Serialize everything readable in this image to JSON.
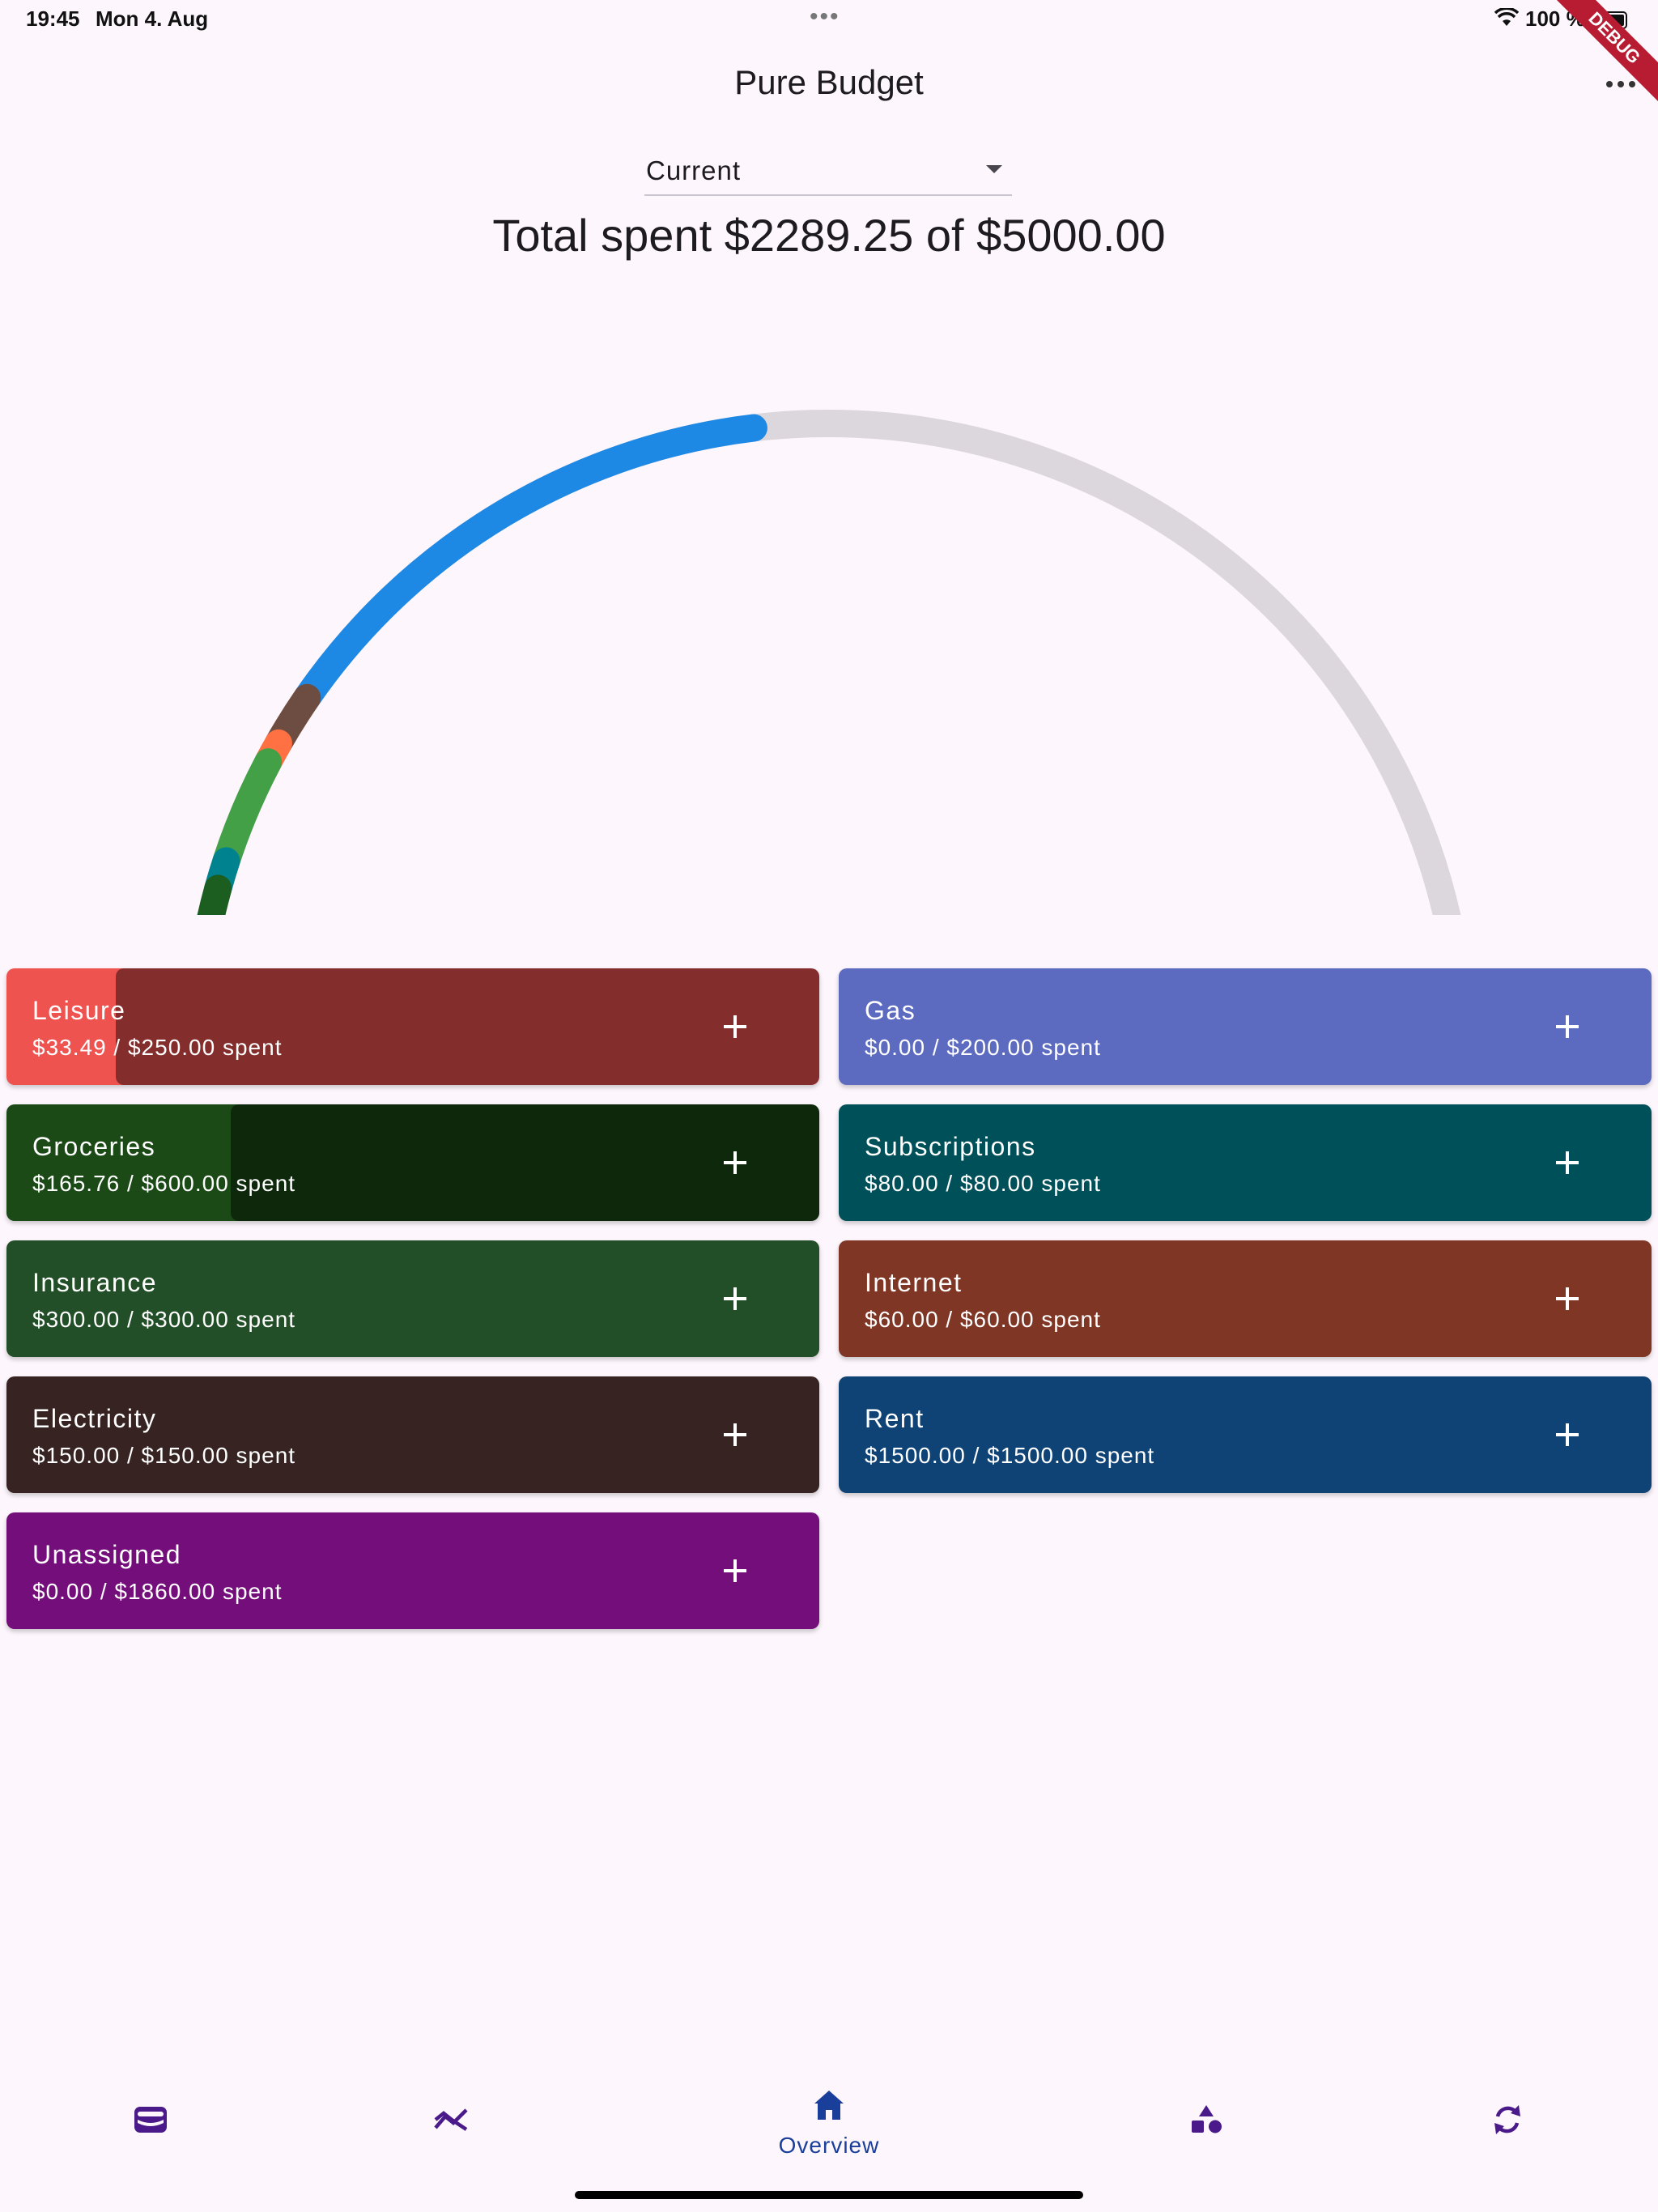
{
  "status_bar": {
    "time": "19:45",
    "date": "Mon 4. Aug",
    "battery": "100 %",
    "dots": "•••"
  },
  "debug_banner": "DEBUG",
  "app": {
    "title": "Pure Budget",
    "more_icon": "more-horizontal-icon"
  },
  "period_selector": {
    "selected": "Current"
  },
  "summary": {
    "total_text": "Total spent $2289.25 of $5000.00",
    "spent": 2289.25,
    "budget": 5000.0
  },
  "gauge": {
    "track_color": "#dcd7dc",
    "segments": [
      {
        "category": "Leisure",
        "value": 33.49,
        "color": "#ef5350"
      },
      {
        "category": "Groceries",
        "value": 165.76,
        "color": "#1b5e20"
      },
      {
        "category": "Subscriptions",
        "value": 80.0,
        "color": "#00838f"
      },
      {
        "category": "Insurance",
        "value": 300.0,
        "color": "#43a047"
      },
      {
        "category": "Internet",
        "value": 60.0,
        "color": "#ff7043"
      },
      {
        "category": "Electricity",
        "value": 150.0,
        "color": "#6d4c41"
      },
      {
        "category": "Rent",
        "value": 1500.0,
        "color": "#1e88e5"
      }
    ]
  },
  "categories": [
    {
      "name": "Leisure",
      "amount_text": "$33.49 / $250.00 spent",
      "spent": 33.49,
      "budget": 250.0,
      "color": "#ef5350"
    },
    {
      "name": "Gas",
      "amount_text": "$0.00 / $200.00 spent",
      "spent": 0.0,
      "budget": 200.0,
      "color": "#5c6bc0"
    },
    {
      "name": "Groceries",
      "amount_text": "$165.76 / $600.00 spent",
      "spent": 165.76,
      "budget": 600.0,
      "color": "#1b4a17"
    },
    {
      "name": "Subscriptions",
      "amount_text": "$80.00 / $80.00 spent",
      "spent": 80.0,
      "budget": 80.0,
      "color": "#00505a"
    },
    {
      "name": "Insurance",
      "amount_text": "$300.00 / $300.00 spent",
      "spent": 300.0,
      "budget": 300.0,
      "color": "#224f27"
    },
    {
      "name": "Internet",
      "amount_text": "$60.00 / $60.00 spent",
      "spent": 60.0,
      "budget": 60.0,
      "color": "#803624"
    },
    {
      "name": "Electricity",
      "amount_text": "$150.00 / $150.00 spent",
      "spent": 150.0,
      "budget": 150.0,
      "color": "#362322"
    },
    {
      "name": "Rent",
      "amount_text": "$1500.00 / $1500.00 spent",
      "spent": 1500.0,
      "budget": 1500.0,
      "color": "#0f4375"
    },
    {
      "name": "Unassigned",
      "amount_text": "$0.00 / $1860.00 spent",
      "spent": 0.0,
      "budget": 1860.0,
      "color": "#740e7a"
    }
  ],
  "bottom_nav": {
    "items": [
      {
        "icon": "wallet-icon",
        "label": ""
      },
      {
        "icon": "trending-icon",
        "label": ""
      },
      {
        "icon": "home-icon",
        "label": "Overview",
        "active": true
      },
      {
        "icon": "shapes-icon",
        "label": ""
      },
      {
        "icon": "sync-icon",
        "label": ""
      }
    ],
    "active_color": "#1a3f9a",
    "icon_color": "#4a1a8a"
  }
}
